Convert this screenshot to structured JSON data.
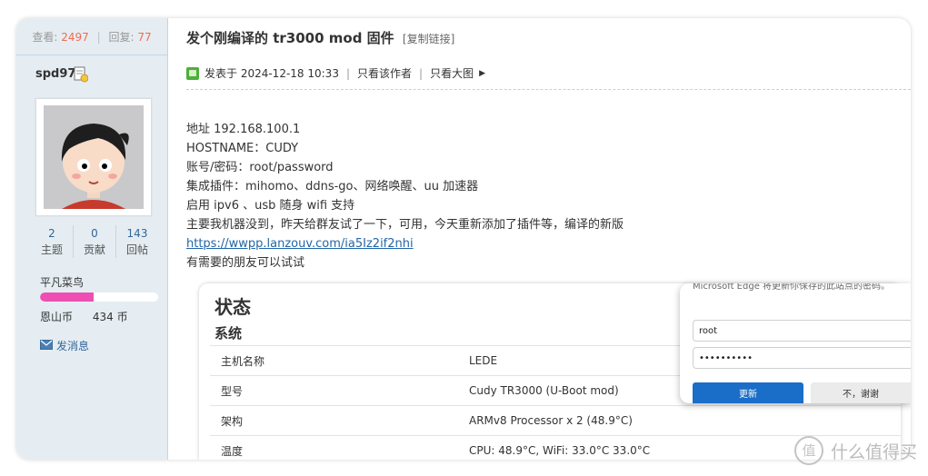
{
  "sidebar": {
    "views_label": "查看:",
    "views_count": "2497",
    "replies_label": "回复:",
    "replies_count": "77",
    "username": "spd97",
    "stats": [
      {
        "value": "2",
        "label": "主题"
      },
      {
        "value": "0",
        "label": "贡献"
      },
      {
        "value": "143",
        "label": "回帖"
      }
    ],
    "rank": "平凡菜鸟",
    "rank_progress": 0.45,
    "coin_label": "恩山币",
    "coin_value": "434 币",
    "message_label": "发消息"
  },
  "post": {
    "title": "发个刚编译的 tr3000 mod 固件",
    "copy_link": "[复制链接]",
    "posted_at": "发表于 2024-12-18 10:33",
    "only_author": "只看该作者",
    "only_large": "只看大图",
    "lines": [
      "地址 192.168.100.1",
      "HOSTNAME：CUDY",
      "账号/密码：root/password",
      "集成插件：mihomo、ddns-go、网络唤醒、uu 加速器",
      "启用 ipv6 、usb 随身 wifi 支持",
      "主要我机器没到，昨天给群友试了一下，可用，今天重新添加了插件等，编译的新版"
    ],
    "link": "https://wwpp.lanzouv.com/ia5Iz2if2nhi",
    "last_line": "有需要的朋友可以试试"
  },
  "screenshot": {
    "status_title": "状态",
    "system_title": "系统",
    "rows": [
      {
        "key": "主机名称",
        "value": "LEDE"
      },
      {
        "key": "型号",
        "value": "Cudy TR3000 (U-Boot mod)"
      },
      {
        "key": "架构",
        "value": "ARMv8 Processor x 2 (48.9°C)"
      },
      {
        "key": "温度",
        "value": "CPU: 48.9°C, WiFi: 33.0°C 33.0°C"
      }
    ]
  },
  "popup": {
    "header": "Microsoft Edge 将更新你保存的此站点的密码。",
    "username": "root",
    "password": "••••••••••",
    "update_button": "更新",
    "no_button": "不，谢谢"
  },
  "watermark": {
    "symbol": "值",
    "text": "什么值得买"
  },
  "colors": {
    "sidebar_bg": "#e5edf2",
    "accent_red": "#f26c4f",
    "link_blue": "#2366a8",
    "progress_pink": "#ee4fb5",
    "update_blue": "#1a6ec7"
  }
}
